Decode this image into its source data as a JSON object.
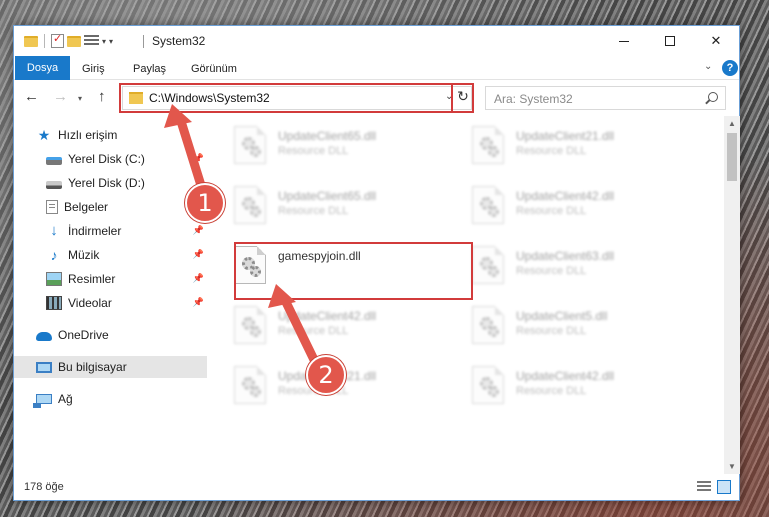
{
  "window": {
    "title": "System32",
    "controls": {
      "minimize": "",
      "maximize": "",
      "close": "✕"
    }
  },
  "ribbon": {
    "tabs": [
      "Dosya",
      "Giriş",
      "Paylaş",
      "Görünüm"
    ],
    "help": "?"
  },
  "navigation": {
    "address": "C:\\Windows\\System32",
    "search_placeholder": "Ara: System32"
  },
  "sidebar": {
    "items": [
      {
        "label": "Hızlı erişim",
        "icon": "star-icon"
      },
      {
        "label": "Yerel Disk (C:)",
        "icon": "drive-icon"
      },
      {
        "label": "Yerel Disk (D:)",
        "icon": "drive-icon"
      },
      {
        "label": "Belgeler",
        "icon": "documents-icon"
      },
      {
        "label": "İndirmeler",
        "icon": "download-icon"
      },
      {
        "label": "Müzik",
        "icon": "music-icon"
      },
      {
        "label": "Resimler",
        "icon": "pictures-icon"
      },
      {
        "label": "Videolar",
        "icon": "video-icon"
      },
      {
        "label": "OneDrive",
        "icon": "cloud-icon"
      },
      {
        "label": "Bu bilgisayar",
        "icon": "computer-icon"
      },
      {
        "label": "Ağ",
        "icon": "network-icon"
      }
    ],
    "selected": "Bu bilgisayar"
  },
  "files": [
    {
      "name": "UpdateClient65.dll",
      "type": "Resource DLL"
    },
    {
      "name": "UpdateClient21.dll",
      "type": "Resource DLL"
    },
    {
      "name": "UpdateClient65.dll",
      "type": "Resource DLL"
    },
    {
      "name": "UpdateClient42.dll",
      "type": "Resource DLL"
    },
    {
      "name": "gamespyjoin.dll",
      "type": ""
    },
    {
      "name": "UpdateClient63.dll",
      "type": "Resource DLL"
    },
    {
      "name": "UpdateClient42.dll",
      "type": "Resource DLL"
    },
    {
      "name": "UpdateClient5.dll",
      "type": "Resource DLL"
    },
    {
      "name": "UpdateClient21.dll",
      "type": "Resource DLL"
    },
    {
      "name": "UpdateClient42.dll",
      "type": "Resource DLL"
    }
  ],
  "status": {
    "count": "178 öğe"
  },
  "annotations": {
    "step1": "1",
    "step2": "2",
    "color": "#e2574c",
    "highlight_color": "#d23b3b"
  }
}
